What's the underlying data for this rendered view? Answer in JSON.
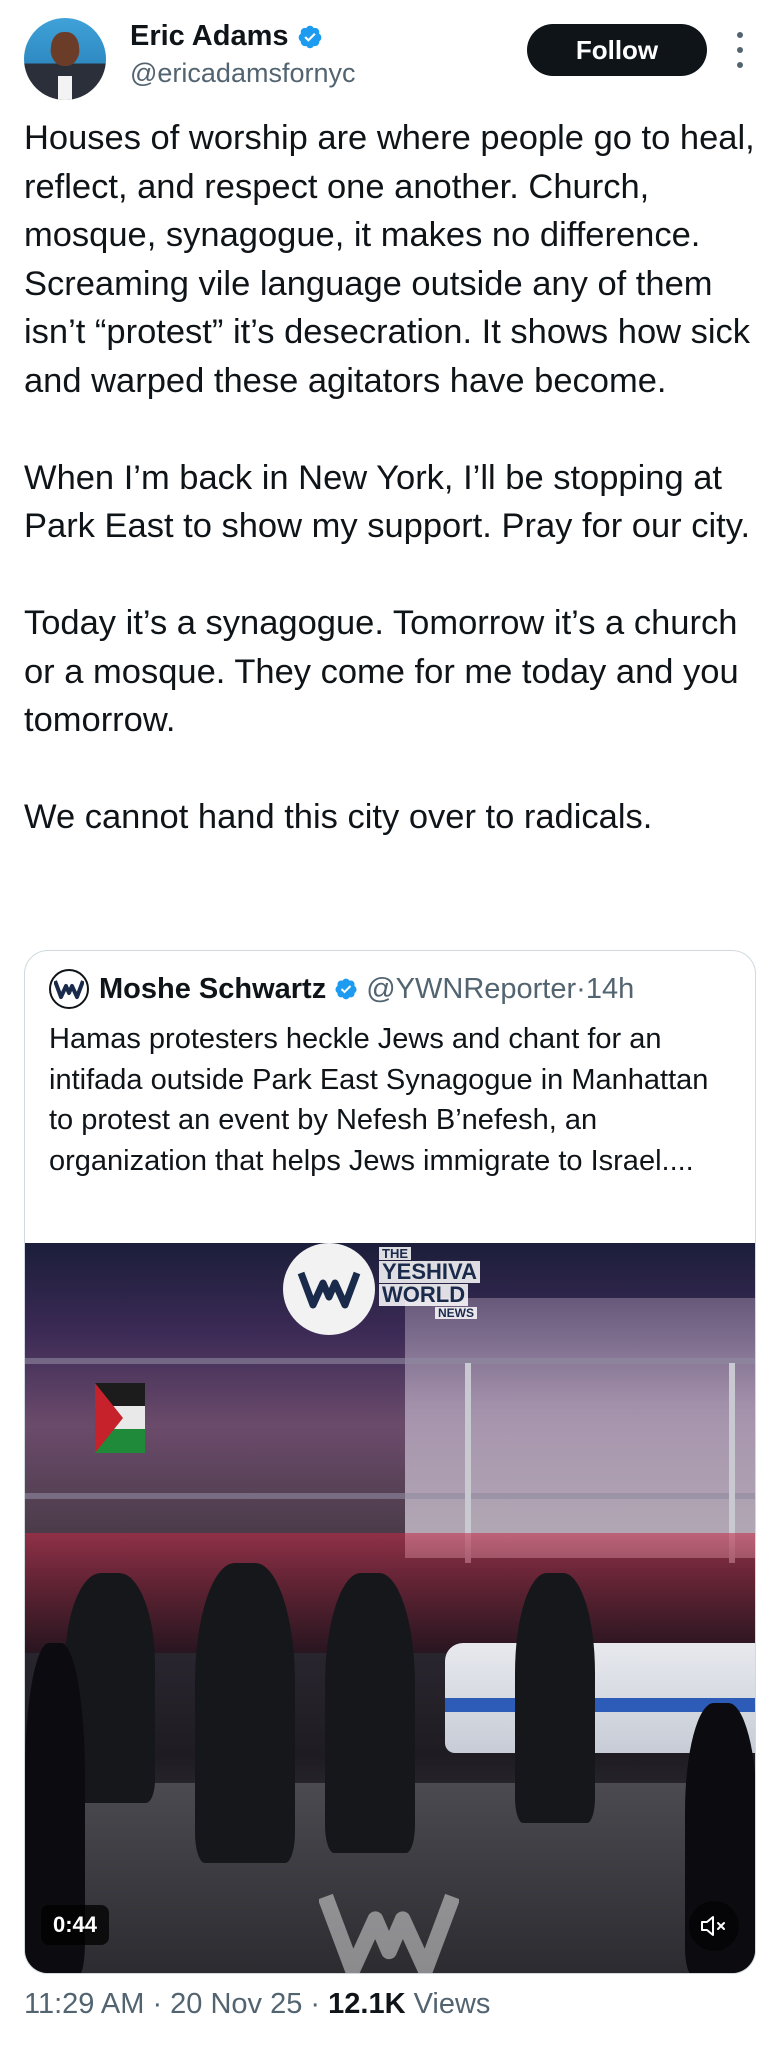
{
  "author": {
    "name": "Eric Adams",
    "handle": "@ericadamsfornyc",
    "follow_label": "Follow"
  },
  "tweet": {
    "paragraphs": [
      "Houses of worship are where people go to heal, reflect, and respect one another. Church, mosque, synagogue, it makes no difference. Screaming vile language outside any of them isn’t “protest” it’s desecration. It shows how sick and warped these agitators have become.",
      "When I’m back in New York, I’ll be stopping at Park East to show my support. Pray for our city.",
      "Today it’s a synagogue. Tomorrow it’s a church or a mosque. They come for me today and you tomorrow.",
      "We cannot hand this city over to radicals."
    ]
  },
  "quoted": {
    "name": "Moshe Schwartz",
    "handle": "@YWNReporter",
    "separator": " · ",
    "time": "14h",
    "text": "Hamas protesters heckle Jews and chant for an intifada outside Park East Synagogue in Manhattan to protest an event by Nefesh B’nefesh, an organization that helps Jews immigrate to Israel....",
    "video": {
      "duration": "0:44",
      "watermark_line1": "THE",
      "watermark_line2": "YESHIVA",
      "watermark_line3": "WORLD",
      "watermark_line4": "NEWS"
    }
  },
  "meta": {
    "time": "11:29 AM",
    "sep1": " · ",
    "date": "20 Nov 25",
    "sep2": " · ",
    "views_count": "12.1K",
    "views_label": " Views"
  },
  "colors": {
    "verified": "#1d9bf0",
    "text": "#0f1419",
    "muted": "#536471",
    "border": "#cfd9de"
  }
}
